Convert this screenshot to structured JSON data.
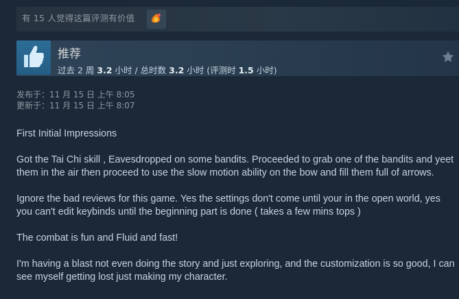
{
  "helpful": {
    "text": "有 15 人觉得这篇评测有价值",
    "award_icon": "award-icon"
  },
  "review_header": {
    "recommendation": "推荐",
    "thumb_icon": "thumbs-up-icon",
    "star_icon": "star-icon",
    "hours_parts": {
      "p1": "过去 2 周 ",
      "v1": "3.2",
      "p2": " 小时 / 总时数 ",
      "v2": "3.2",
      "p3": " 小时  (评测时 ",
      "v3": "1.5",
      "p4": " 小时)"
    }
  },
  "dates": {
    "posted": "发布于：11 月 15 日 上午 8:05",
    "updated": "更新于：11 月 15 日 上午 8:07"
  },
  "review_paragraphs": [
    "First Initial Impressions",
    "Got the Tai Chi skill , Eavesdropped on some bandits. Proceeded to grab one of the bandits and yeet them in the air then proceed to use the slow motion ability on the bow and fill them full of arrows.",
    "Ignore the bad reviews for this game. Yes the settings don't come until your in the open world, yes you can't edit keybinds until the beginning part is done ( takes a few mins tops )",
    "The combat is fun and Fluid and fast!",
    "I'm having a blast not even doing the story and just exploring, and the customization is so good, I can see myself getting lost just making my character."
  ],
  "colors": {
    "background": "#1b2838",
    "thumb_bg": "#2a6790",
    "text": "#c6d4df",
    "muted": "#8f98a0"
  }
}
